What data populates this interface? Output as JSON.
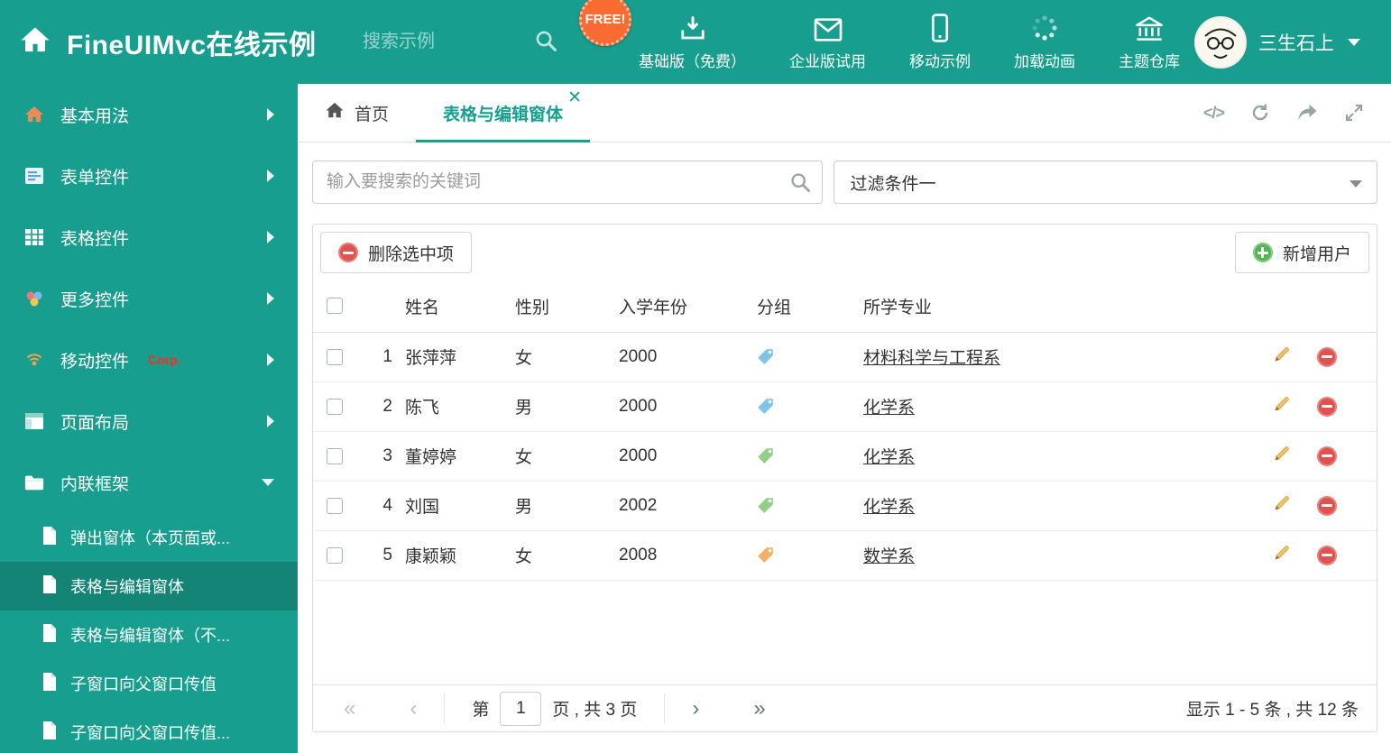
{
  "header": {
    "title": "FineUIMvc在线示例",
    "search_placeholder": "搜索示例",
    "free_badge": "FREE!",
    "nav": [
      {
        "label": "基础版（免费）"
      },
      {
        "label": "企业版试用"
      },
      {
        "label": "移动示例"
      },
      {
        "label": "加载动画"
      },
      {
        "label": "主题仓库"
      }
    ],
    "user_name": "三生石上"
  },
  "sidebar": {
    "items": [
      {
        "label": "基本用法"
      },
      {
        "label": "表单控件"
      },
      {
        "label": "表格控件"
      },
      {
        "label": "更多控件"
      },
      {
        "label": "移动控件",
        "tag": "Corp."
      },
      {
        "label": "页面布局"
      },
      {
        "label": "内联框架"
      }
    ],
    "subitems": [
      {
        "label": "弹出窗体（本页面或..."
      },
      {
        "label": "表格与编辑窗体"
      },
      {
        "label": "表格与编辑窗体（不..."
      },
      {
        "label": "子窗口向父窗口传值"
      },
      {
        "label": "子窗口向父窗口传值..."
      }
    ]
  },
  "tabs": {
    "home": "首页",
    "active": "表格与编辑窗体"
  },
  "filters": {
    "search_placeholder": "输入要搜索的关键词",
    "filter_selected": "过滤条件一"
  },
  "toolbar": {
    "delete_label": "删除选中项",
    "add_label": "新增用户"
  },
  "table": {
    "headers": {
      "name": "姓名",
      "gender": "性别",
      "year": "入学年份",
      "group": "分组",
      "major": "所学专业"
    },
    "rows": [
      {
        "num": "1",
        "name": "张萍萍",
        "gender": "女",
        "year": "2000",
        "tag_color": "#7fc4ea",
        "major": "材料科学与工程系"
      },
      {
        "num": "2",
        "name": "陈飞",
        "gender": "男",
        "year": "2000",
        "tag_color": "#7fc4ea",
        "major": "化学系"
      },
      {
        "num": "3",
        "name": "董婷婷",
        "gender": "女",
        "year": "2000",
        "tag_color": "#94cf85",
        "major": "化学系"
      },
      {
        "num": "4",
        "name": "刘国",
        "gender": "男",
        "year": "2002",
        "tag_color": "#94cf85",
        "major": "化学系"
      },
      {
        "num": "5",
        "name": "康颖颖",
        "gender": "女",
        "year": "2008",
        "tag_color": "#f3b064",
        "major": "数学系"
      }
    ]
  },
  "pagination": {
    "page_prefix": "第",
    "page_value": "1",
    "page_suffix": "页 , 共 3 页",
    "summary": "显示 1 - 5 条 , 共 12 条"
  },
  "colors": {
    "theme_teal": "#189e8e",
    "danger_red": "#e0524e",
    "success_green": "#54b557",
    "free_orange": "#f96b31"
  }
}
